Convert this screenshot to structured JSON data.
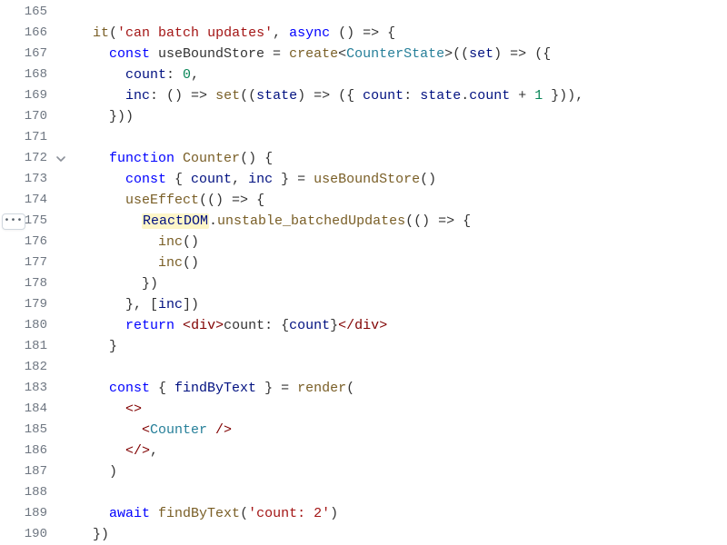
{
  "gutter": {
    "more_actions_icon": "•••",
    "fold_icon": "⌄"
  },
  "lines": [
    {
      "n": 165,
      "tokens": []
    },
    {
      "n": 166,
      "indent": 1,
      "tokens": [
        {
          "t": "it",
          "c": "fn"
        },
        {
          "t": "("
        },
        {
          "t": "'can batch updates'",
          "c": "str"
        },
        {
          "t": ", "
        },
        {
          "t": "async",
          "c": "kw"
        },
        {
          "t": " () "
        },
        {
          "t": "=>",
          "c": "op"
        },
        {
          "t": " {"
        }
      ]
    },
    {
      "n": 167,
      "indent": 2,
      "tokens": [
        {
          "t": "const",
          "c": "kw"
        },
        {
          "t": " useBoundStore = "
        },
        {
          "t": "create",
          "c": "fn"
        },
        {
          "t": "<"
        },
        {
          "t": "CounterState",
          "c": "type"
        },
        {
          "t": ">(("
        },
        {
          "t": "set",
          "c": "var"
        },
        {
          "t": ") "
        },
        {
          "t": "=>",
          "c": "op"
        },
        {
          "t": " ({"
        }
      ]
    },
    {
      "n": 168,
      "indent": 3,
      "tokens": [
        {
          "t": "count",
          "c": "prop"
        },
        {
          "t": ": "
        },
        {
          "t": "0",
          "c": "num"
        },
        {
          "t": ","
        }
      ]
    },
    {
      "n": 169,
      "indent": 3,
      "tokens": [
        {
          "t": "inc",
          "c": "prop"
        },
        {
          "t": ": () "
        },
        {
          "t": "=>",
          "c": "op"
        },
        {
          "t": " "
        },
        {
          "t": "set",
          "c": "fn"
        },
        {
          "t": "(("
        },
        {
          "t": "state",
          "c": "var"
        },
        {
          "t": ") "
        },
        {
          "t": "=>",
          "c": "op"
        },
        {
          "t": " ({ "
        },
        {
          "t": "count",
          "c": "prop"
        },
        {
          "t": ": "
        },
        {
          "t": "state",
          "c": "var"
        },
        {
          "t": "."
        },
        {
          "t": "count",
          "c": "prop"
        },
        {
          "t": " + "
        },
        {
          "t": "1",
          "c": "num"
        },
        {
          "t": " })),"
        }
      ]
    },
    {
      "n": 170,
      "indent": 2,
      "tokens": [
        {
          "t": "}))"
        }
      ]
    },
    {
      "n": 171,
      "indent": 0,
      "tokens": []
    },
    {
      "n": 172,
      "indent": 2,
      "fold": true,
      "tokens": [
        {
          "t": "function",
          "c": "kw"
        },
        {
          "t": " "
        },
        {
          "t": "Counter",
          "c": "fn"
        },
        {
          "t": "() {"
        }
      ]
    },
    {
      "n": 173,
      "indent": 3,
      "tokens": [
        {
          "t": "const",
          "c": "kw"
        },
        {
          "t": " { "
        },
        {
          "t": "count",
          "c": "var"
        },
        {
          "t": ", "
        },
        {
          "t": "inc",
          "c": "var"
        },
        {
          "t": " } = "
        },
        {
          "t": "useBoundStore",
          "c": "fn"
        },
        {
          "t": "()"
        }
      ]
    },
    {
      "n": 174,
      "indent": 3,
      "tokens": [
        {
          "t": "useEffect",
          "c": "fn"
        },
        {
          "t": "(() "
        },
        {
          "t": "=>",
          "c": "op"
        },
        {
          "t": " {"
        }
      ]
    },
    {
      "n": 175,
      "indent": 4,
      "more": true,
      "tokens": [
        {
          "t": "ReactDOM",
          "c": "var",
          "hl": true
        },
        {
          "t": "."
        },
        {
          "t": "unstable_batchedUpdates",
          "c": "fn"
        },
        {
          "t": "(() "
        },
        {
          "t": "=>",
          "c": "op"
        },
        {
          "t": " {"
        }
      ]
    },
    {
      "n": 176,
      "indent": 5,
      "tokens": [
        {
          "t": "inc",
          "c": "fn"
        },
        {
          "t": "()"
        }
      ]
    },
    {
      "n": 177,
      "indent": 5,
      "tokens": [
        {
          "t": "inc",
          "c": "fn"
        },
        {
          "t": "()"
        }
      ]
    },
    {
      "n": 178,
      "indent": 4,
      "tokens": [
        {
          "t": "})"
        }
      ]
    },
    {
      "n": 179,
      "indent": 3,
      "tokens": [
        {
          "t": "}, ["
        },
        {
          "t": "inc",
          "c": "var"
        },
        {
          "t": "])"
        }
      ]
    },
    {
      "n": 180,
      "indent": 3,
      "tokens": [
        {
          "t": "return",
          "c": "kw"
        },
        {
          "t": " "
        },
        {
          "t": "<",
          "c": "tagPunc"
        },
        {
          "t": "div",
          "c": "tag"
        },
        {
          "t": ">",
          "c": "tagPunc"
        },
        {
          "t": "count: "
        },
        {
          "t": "{"
        },
        {
          "t": "count",
          "c": "var"
        },
        {
          "t": "}"
        },
        {
          "t": "</",
          "c": "tagPunc"
        },
        {
          "t": "div",
          "c": "tag"
        },
        {
          "t": ">",
          "c": "tagPunc"
        }
      ]
    },
    {
      "n": 181,
      "indent": 2,
      "tokens": [
        {
          "t": "}"
        }
      ]
    },
    {
      "n": 182,
      "indent": 0,
      "tokens": []
    },
    {
      "n": 183,
      "indent": 2,
      "tokens": [
        {
          "t": "const",
          "c": "kw"
        },
        {
          "t": " { "
        },
        {
          "t": "findByText",
          "c": "var"
        },
        {
          "t": " } = "
        },
        {
          "t": "render",
          "c": "fn"
        },
        {
          "t": "("
        }
      ]
    },
    {
      "n": 184,
      "indent": 3,
      "tokens": [
        {
          "t": "<>",
          "c": "tagPunc"
        }
      ]
    },
    {
      "n": 185,
      "indent": 4,
      "tokens": [
        {
          "t": "<",
          "c": "tagPunc"
        },
        {
          "t": "Counter",
          "c": "type"
        },
        {
          "t": " />",
          "c": "tagPunc"
        }
      ]
    },
    {
      "n": 186,
      "indent": 3,
      "tokens": [
        {
          "t": "</>",
          "c": "tagPunc"
        },
        {
          "t": ","
        }
      ]
    },
    {
      "n": 187,
      "indent": 2,
      "tokens": [
        {
          "t": ")"
        }
      ]
    },
    {
      "n": 188,
      "indent": 0,
      "tokens": []
    },
    {
      "n": 189,
      "indent": 2,
      "tokens": [
        {
          "t": "await",
          "c": "kw"
        },
        {
          "t": " "
        },
        {
          "t": "findByText",
          "c": "fn"
        },
        {
          "t": "("
        },
        {
          "t": "'count: 2'",
          "c": "str"
        },
        {
          "t": ")"
        }
      ]
    },
    {
      "n": 190,
      "indent": 1,
      "tokens": [
        {
          "t": "})"
        }
      ]
    }
  ],
  "indent_unit": "  "
}
